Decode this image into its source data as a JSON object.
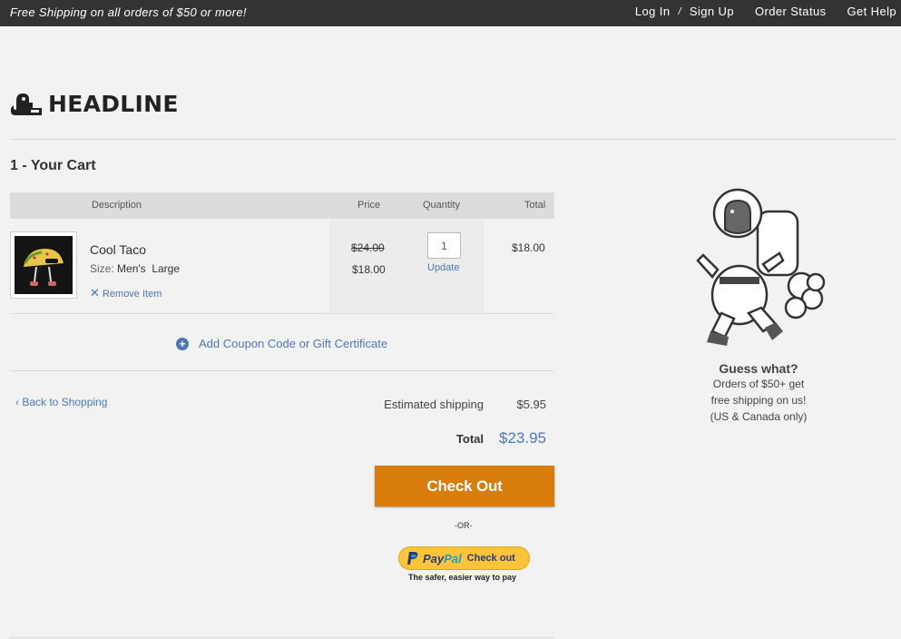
{
  "topbar": {
    "promo": "Free Shipping on all orders of $50 or more!",
    "login": "Log In",
    "separator": "/",
    "signup": "Sign Up",
    "order_status": "Order Status",
    "get_help": "Get Help"
  },
  "brand": {
    "name": "HEADLINE"
  },
  "cart": {
    "step_title": "1 - Your Cart",
    "columns": {
      "description": "Description",
      "price": "Price",
      "quantity": "Quantity",
      "total": "Total"
    },
    "item": {
      "name": "Cool Taco",
      "size_label": "Size:",
      "size_value": "Men's  Large",
      "remove": "Remove Item",
      "original_price": "$24.00",
      "price": "$18.00",
      "quantity": "1",
      "update": "Update",
      "total": "$18.00"
    },
    "coupon": "Add Coupon Code or Gift Certificate",
    "back": "‹ Back to Shopping",
    "shipping_label": "Estimated shipping",
    "shipping_value": "$5.95",
    "total_label": "Total",
    "total_value": "$23.95",
    "checkout": "Check Out",
    "or": "-OR-",
    "paypal": {
      "pay": "Pay",
      "pal": "Pal",
      "checkout": "Check out",
      "tagline": "The safer, easier way to pay"
    }
  },
  "promo_box": {
    "heading": "Guess what?",
    "line1": "Orders of $50+ get",
    "line2": "free shipping on us!",
    "line3": "(US & Canada only)"
  },
  "colors": {
    "accent": "#4d79b2",
    "checkout": "#d87c0b",
    "topbar": "#333333"
  }
}
